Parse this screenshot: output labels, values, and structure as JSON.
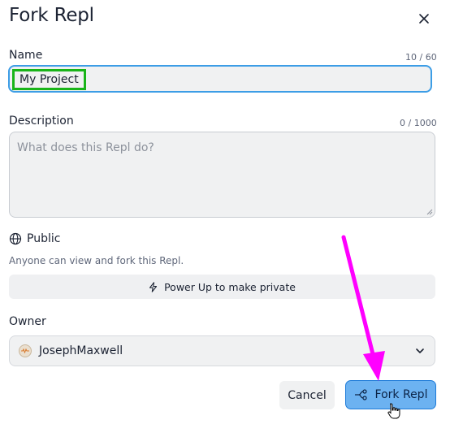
{
  "dialog": {
    "title": "Fork Repl",
    "close_icon": "close-icon"
  },
  "name_field": {
    "label": "Name",
    "counter": "10 / 60",
    "value": "My Project"
  },
  "description_field": {
    "label": "Description",
    "counter": "0 / 1000",
    "placeholder": "What does this Repl do?"
  },
  "visibility": {
    "icon": "globe-icon",
    "label": "Public",
    "description": "Anyone can view and fork this Repl.",
    "powerup_icon": "lightning-icon",
    "powerup_label": "Power Up to make private"
  },
  "owner": {
    "label": "Owner",
    "value": "JosephMaxwell",
    "dropdown_icon": "chevron-down-icon"
  },
  "actions": {
    "cancel_label": "Cancel",
    "fork_label": "Fork Repl",
    "fork_icon": "fork-icon"
  },
  "colors": {
    "accent": "#3c9de6",
    "primary_button": "#6cb2f1",
    "highlight_box": "#19b419",
    "annotation_arrow": "#ff00ff"
  }
}
